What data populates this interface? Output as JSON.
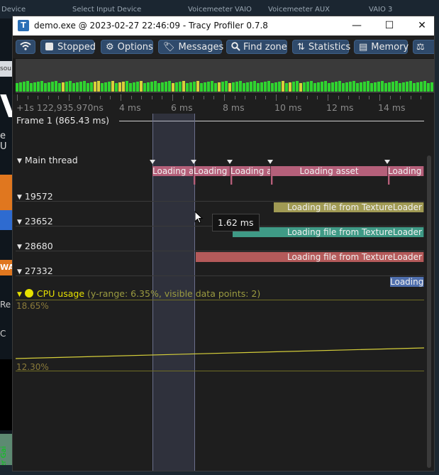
{
  "background": {
    "labels": [
      "Device",
      "Select Input Device",
      "Voicemeeter VAIO",
      "Voicemeeter AUX",
      "VAIO 3"
    ],
    "left_snippets": [
      "sou",
      "V",
      "e U",
      "Re",
      "C",
      "WA",
      "ader Gai"
    ]
  },
  "window": {
    "icon_letter": "T",
    "title": "demo.exe @ 2023-02-27 22:46:09 - Tracy Profiler 0.7.8",
    "minimize": "—",
    "maximize": "☐",
    "close": "✕"
  },
  "toolbar": {
    "buttons": [
      {
        "label": "",
        "icon": "wifi-icon"
      },
      {
        "label": "Stopped",
        "icon": "checkbox-icon"
      },
      {
        "label": "Options",
        "icon": "gear-icon"
      },
      {
        "label": "Messages",
        "icon": "tag-icon"
      },
      {
        "label": "Find zone",
        "icon": "search-icon"
      },
      {
        "label": "Statistics",
        "icon": "sort-icon"
      },
      {
        "label": "Memory",
        "icon": "memory-icon"
      },
      {
        "label": "",
        "icon": "scale-icon"
      }
    ]
  },
  "timeline": {
    "ruler_origin": "+1s 122,935.970ns",
    "ruler_ticks": [
      "4 ms",
      "6 ms",
      "8 ms",
      "10 ms",
      "12 ms",
      "14 ms"
    ],
    "frame_label": "Frame 1 (865.43 ms)",
    "tooltip": "1.62 ms",
    "threads": [
      {
        "name": "Main thread",
        "zones": [
          "Loading asset",
          "Loading asset",
          "Loading asset",
          "Loading asset",
          "Loading asset"
        ]
      },
      {
        "name": "19572",
        "zones": [
          "Loading file from TextureLoader"
        ]
      },
      {
        "name": "23652",
        "zones": [
          "Loading file from TextureLoader"
        ]
      },
      {
        "name": "28680",
        "zones": [
          "Loading file from TextureLoader"
        ]
      },
      {
        "name": "27332",
        "zones": [
          "Loading"
        ]
      }
    ],
    "zone_colors": {
      "main": "#b5607a",
      "t19572": "#a09a54",
      "t23652": "#3f9a86",
      "t28680": "#b45a5a",
      "t27332": "#4f6fae"
    },
    "cpu": {
      "label": "CPU usage",
      "subtitle": "(y-range: 6.35%, visible data points: 2)",
      "max": "18.65%",
      "min": "12.30%"
    }
  }
}
